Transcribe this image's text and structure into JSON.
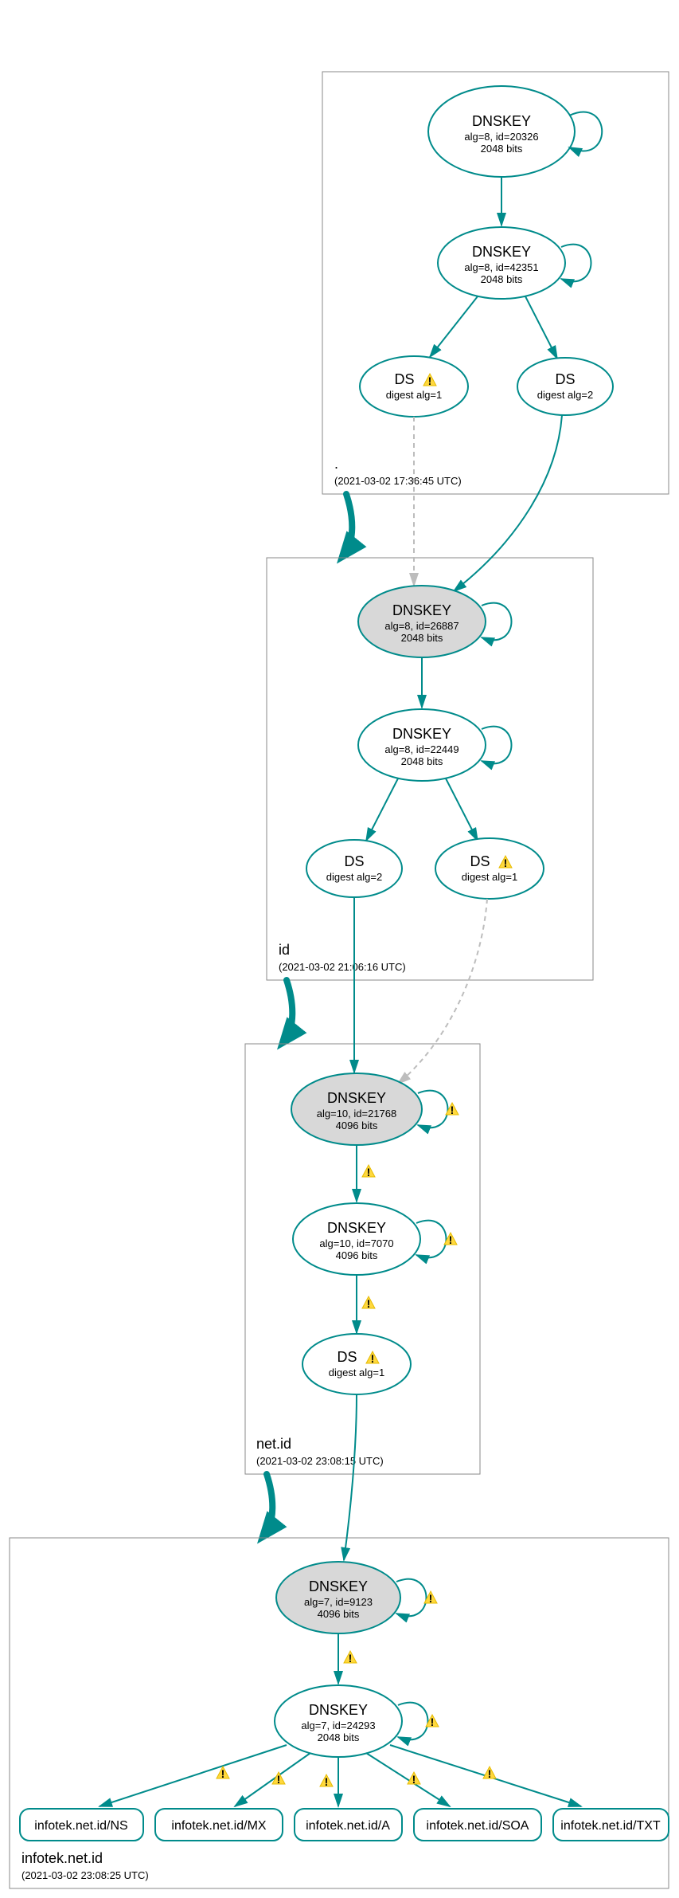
{
  "zones": {
    "root": {
      "name": ".",
      "timestamp": "(2021-03-02 17:36:45 UTC)"
    },
    "id": {
      "name": "id",
      "timestamp": "(2021-03-02 21:06:16 UTC)"
    },
    "netid": {
      "name": "net.id",
      "timestamp": "(2021-03-02 23:08:15 UTC)"
    },
    "infotek": {
      "name": "infotek.net.id",
      "timestamp": "(2021-03-02 23:08:25 UTC)"
    }
  },
  "nodes": {
    "root_ksk": {
      "title": "DNSKEY",
      "line1": "alg=8, id=20326",
      "line2": "2048 bits"
    },
    "root_zsk": {
      "title": "DNSKEY",
      "line1": "alg=8, id=42351",
      "line2": "2048 bits"
    },
    "root_ds1": {
      "title": "DS",
      "line1": "digest alg=1"
    },
    "root_ds2": {
      "title": "DS",
      "line1": "digest alg=2"
    },
    "id_ksk": {
      "title": "DNSKEY",
      "line1": "alg=8, id=26887",
      "line2": "2048 bits"
    },
    "id_zsk": {
      "title": "DNSKEY",
      "line1": "alg=8, id=22449",
      "line2": "2048 bits"
    },
    "id_ds2": {
      "title": "DS",
      "line1": "digest alg=2"
    },
    "id_ds1": {
      "title": "DS",
      "line1": "digest alg=1"
    },
    "netid_ksk": {
      "title": "DNSKEY",
      "line1": "alg=10, id=21768",
      "line2": "4096 bits"
    },
    "netid_zsk": {
      "title": "DNSKEY",
      "line1": "alg=10, id=7070",
      "line2": "4096 bits"
    },
    "netid_ds1": {
      "title": "DS",
      "line1": "digest alg=1"
    },
    "infotek_ksk": {
      "title": "DNSKEY",
      "line1": "alg=7, id=9123",
      "line2": "4096 bits"
    },
    "infotek_zsk": {
      "title": "DNSKEY",
      "line1": "alg=7, id=24293",
      "line2": "2048 bits"
    },
    "rr_ns": {
      "title": "infotek.net.id/NS"
    },
    "rr_mx": {
      "title": "infotek.net.id/MX"
    },
    "rr_a": {
      "title": "infotek.net.id/A"
    },
    "rr_soa": {
      "title": "infotek.net.id/SOA"
    },
    "rr_txt": {
      "title": "infotek.net.id/TXT"
    }
  }
}
